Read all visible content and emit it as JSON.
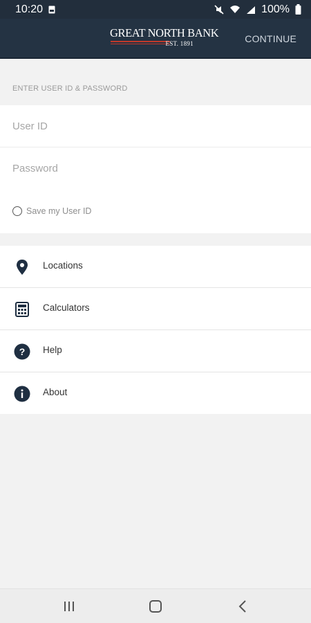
{
  "status_bar": {
    "time": "10:20",
    "battery": "100%"
  },
  "header": {
    "logo_name": "GREAT NORTH BANK",
    "logo_est": "EST. 1891",
    "continue_label": "CONTINUE"
  },
  "login": {
    "section_label": "ENTER USER ID & PASSWORD",
    "user_id_placeholder": "User ID",
    "password_placeholder": "Password",
    "save_user_label": "Save my User ID",
    "save_user_checked": false
  },
  "menu": {
    "items": [
      {
        "label": "Locations",
        "icon": "location-pin-icon"
      },
      {
        "label": "Calculators",
        "icon": "calculator-icon"
      },
      {
        "label": "Help",
        "icon": "help-icon"
      },
      {
        "label": "About",
        "icon": "info-icon"
      }
    ]
  },
  "nav_bar": {
    "buttons": [
      "recent-apps-icon",
      "home-icon",
      "back-icon"
    ]
  },
  "colors": {
    "header_bg": "#243343",
    "accent_red": "#c0392b",
    "icon_dark": "#1f2f42",
    "page_bg": "#f2f2f2"
  }
}
